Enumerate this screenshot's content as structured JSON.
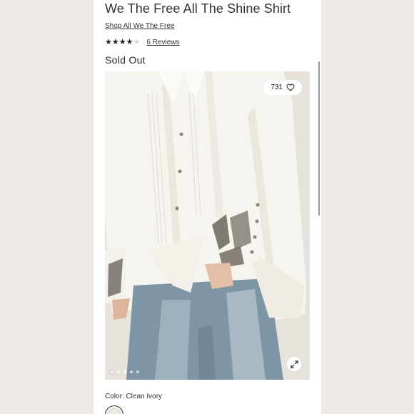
{
  "product": {
    "title": "We The Free All The Shine Shirt",
    "shop_link": "Shop All We The Free",
    "rating": {
      "value": 4,
      "max": 5
    },
    "reviews_label": "6 Reviews",
    "status": "Sold Out"
  },
  "gallery": {
    "favorites_count": "731",
    "favorite_icon": "heart-icon",
    "expand_icon": "expand-arrows-icon",
    "image_count": 5,
    "active_index": 0
  },
  "color": {
    "label": "Color: Clean Ivory",
    "swatch_hex": "#efebe2"
  },
  "colors": {
    "page_background": "#f3eeea",
    "panel_background": "#ffffff",
    "text": "#2a2a2a"
  }
}
